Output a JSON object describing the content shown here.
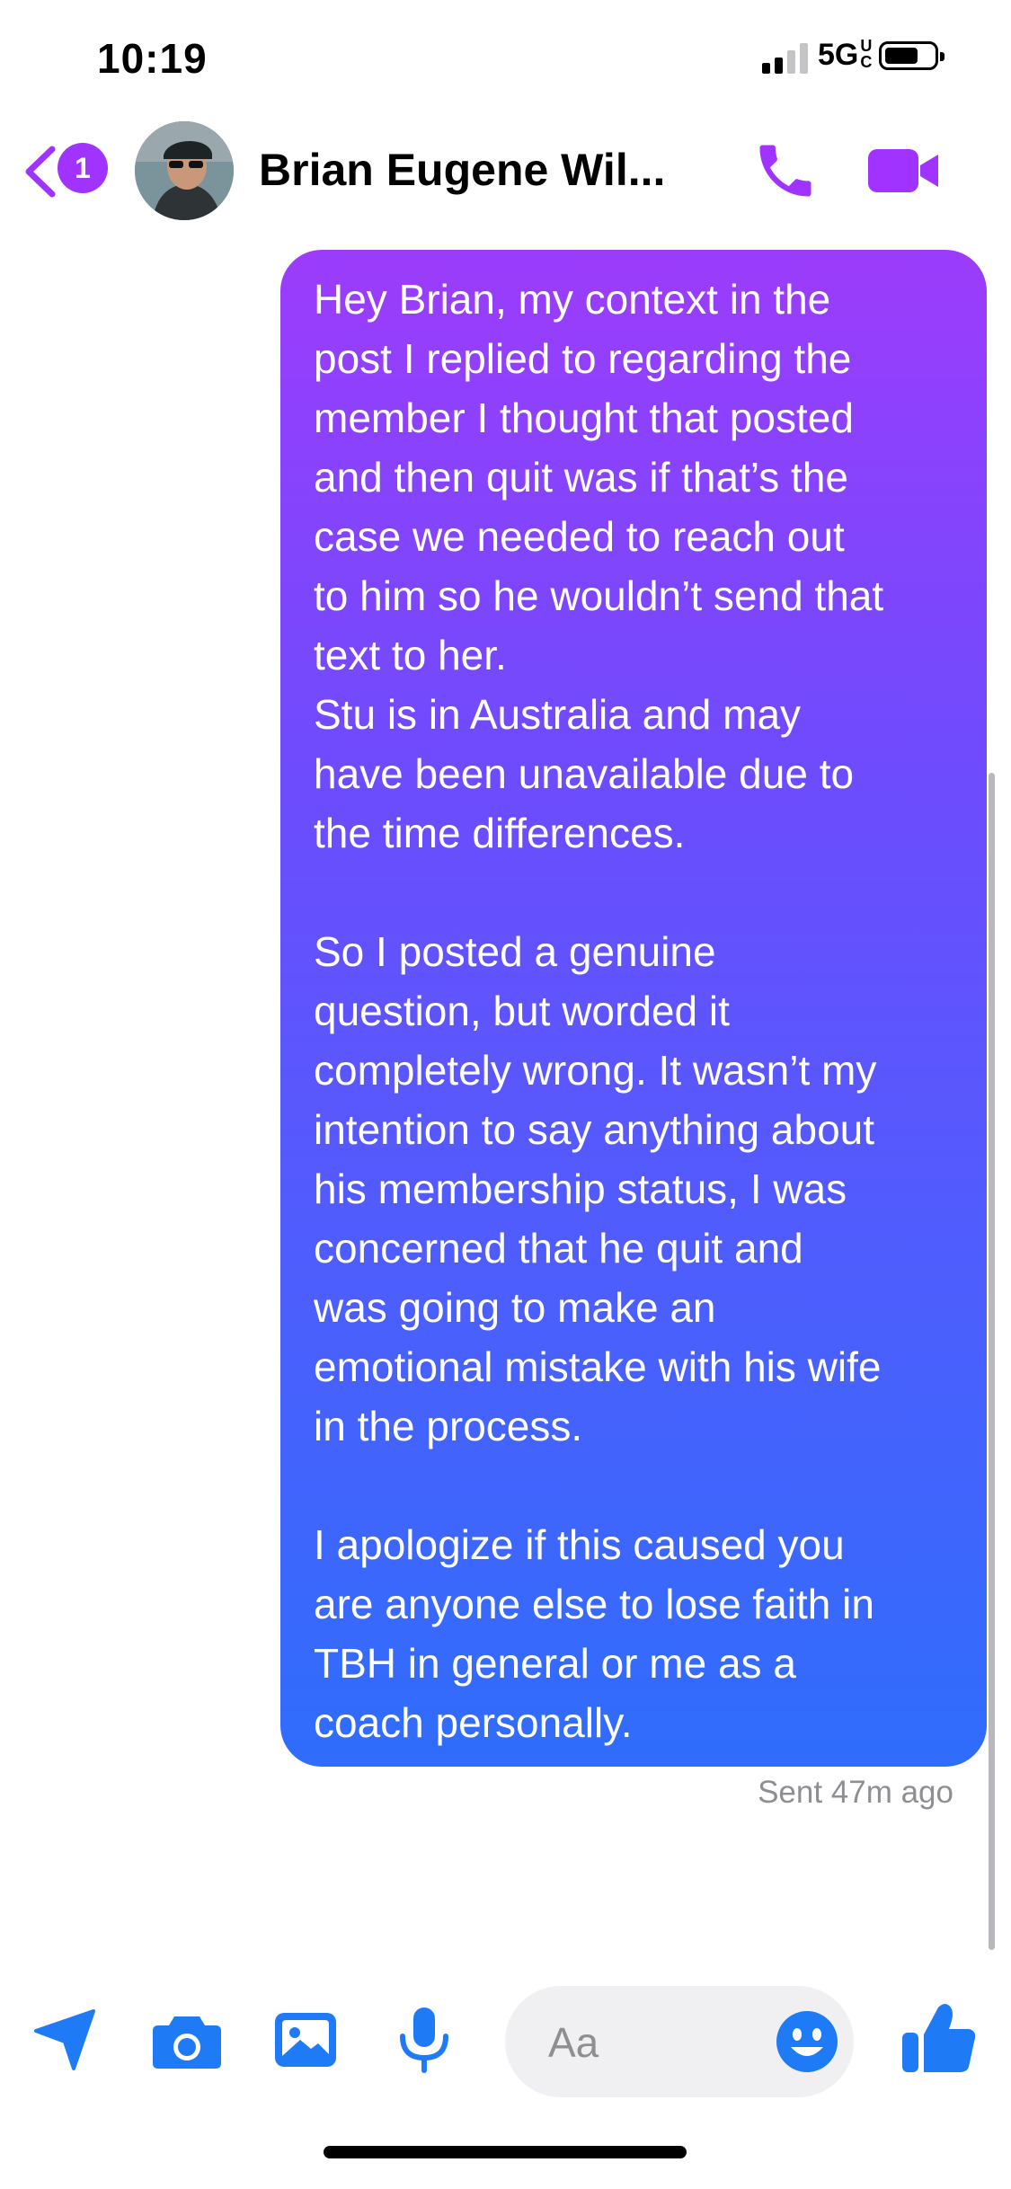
{
  "status_bar": {
    "time": "10:19",
    "network": "5G",
    "network_sub": "UC"
  },
  "header": {
    "unread_count": "1",
    "contact_name": "Brian Eugene Wil..."
  },
  "message": {
    "paragraphs": [
      "Hey Brian, my context in the\npost I replied to regarding the\nmember I thought that posted\nand then quit was if that’s the\ncase we needed to reach out\nto him so he wouldn’t send that\ntext to her.\nStu is in Australia and may\nhave been unavailable due to\nthe time differences.",
      "So I posted a genuine\nquestion, but worded it\ncompletely wrong. It wasn’t my\nintention to say anything about\nhis membership status, I was\nconcerned that he quit and\nwas going to make an\nemotional mistake with his wife\nin the process.",
      "I apologize if this caused you\nare anyone else to lose faith in\nTBH in general or me as a\ncoach personally."
    ],
    "status": "Sent 47m ago"
  },
  "composer": {
    "placeholder": "Aa"
  },
  "icons": [
    "back-chevron-icon",
    "phone-icon",
    "video-camera-icon",
    "send-location-icon",
    "camera-icon",
    "gallery-icon",
    "microphone-icon",
    "emoji-icon",
    "thumbs-up-icon"
  ],
  "colors": {
    "accent_purple": "#a033ff",
    "accent_blue": "#1e7bf5",
    "bubble_top": "#9c3cfb",
    "bubble_bottom": "#2f6dfc"
  }
}
